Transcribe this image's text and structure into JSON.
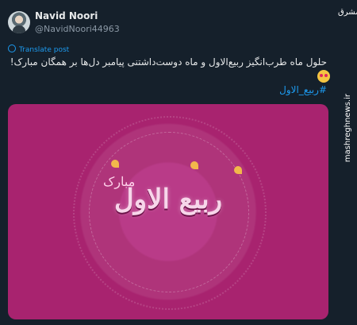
{
  "author": {
    "name": "Navid Noori",
    "handle": "@NavidNoori44963"
  },
  "translate_label": "Translate post",
  "tweet_text": "حلول ماه طرب‌انگیز ربیع‌الاول و ماه دوست‌داشتنی پیامبر دل‌ها بر همگان مبارک!",
  "hashtag": "#ربیع_الاول",
  "media": {
    "calligraphy": "ربیع الاول",
    "calligraphy_sub": "مبارک",
    "background_color": "#a8236f"
  },
  "watermark": {
    "logo": "مشرق",
    "site": "mashreghnews.ir"
  },
  "icons": {
    "pin": "round-pushpin-icon",
    "emoji": "heart-eyes-emoji-icon"
  }
}
